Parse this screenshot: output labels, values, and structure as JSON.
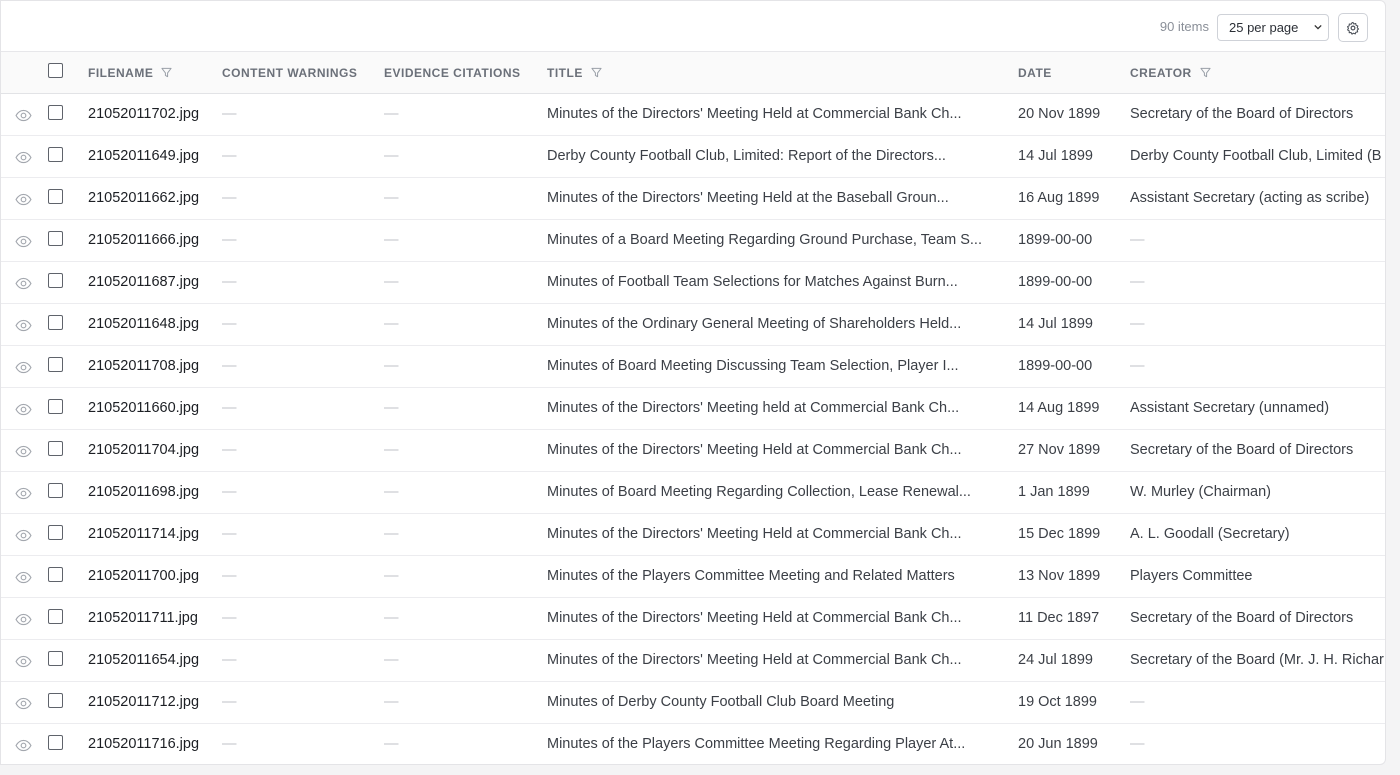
{
  "toolbar": {
    "item_count": "90 items",
    "per_page": "25 per page",
    "settings_icon": "gear-icon"
  },
  "columns": {
    "filename": "FILENAME",
    "content_warnings": "CONTENT WARNINGS",
    "evidence_citations": "EVIDENCE CITATIONS",
    "title": "TITLE",
    "date": "DATE",
    "creator": "CREATOR"
  },
  "empty_placeholder": "—",
  "rows": [
    {
      "filename": "21052011702.jpg",
      "title": "Minutes of the Directors' Meeting Held at Commercial Bank Ch...",
      "date": "20 Nov 1899",
      "creator": "Secretary of the Board of Directors"
    },
    {
      "filename": "21052011649.jpg",
      "title": "Derby County Football Club, Limited: Report of the Directors...",
      "date": "14 Jul 1899",
      "creator": "Derby County Football Club, Limited (B"
    },
    {
      "filename": "21052011662.jpg",
      "title": "Minutes of the Directors' Meeting Held at the Baseball Groun...",
      "date": "16 Aug 1899",
      "creator": "Assistant Secretary (acting as scribe)"
    },
    {
      "filename": "21052011666.jpg",
      "title": "Minutes of a Board Meeting Regarding Ground Purchase, Team S...",
      "date": "1899-00-00",
      "creator": "—"
    },
    {
      "filename": "21052011687.jpg",
      "title": "Minutes of Football Team Selections for Matches Against Burn...",
      "date": "1899-00-00",
      "creator": "—"
    },
    {
      "filename": "21052011648.jpg",
      "title": "Minutes of the Ordinary General Meeting of Shareholders Held...",
      "date": "14 Jul 1899",
      "creator": "—"
    },
    {
      "filename": "21052011708.jpg",
      "title": "Minutes of Board Meeting Discussing Team Selection, Player I...",
      "date": "1899-00-00",
      "creator": "—"
    },
    {
      "filename": "21052011660.jpg",
      "title": "Minutes of the Directors' Meeting held at Commercial Bank Ch...",
      "date": "14 Aug 1899",
      "creator": "Assistant Secretary (unnamed)"
    },
    {
      "filename": "21052011704.jpg",
      "title": "Minutes of the Directors' Meeting Held at Commercial Bank Ch...",
      "date": "27 Nov 1899",
      "creator": "Secretary of the Board of Directors"
    },
    {
      "filename": "21052011698.jpg",
      "title": "Minutes of Board Meeting Regarding Collection, Lease Renewal...",
      "date": "1 Jan 1899",
      "creator": "W. Murley (Chairman)"
    },
    {
      "filename": "21052011714.jpg",
      "title": "Minutes of the Directors' Meeting Held at Commercial Bank Ch...",
      "date": "15 Dec 1899",
      "creator": "A. L. Goodall (Secretary)"
    },
    {
      "filename": "21052011700.jpg",
      "title": "Minutes of the Players Committee Meeting and Related Matters",
      "date": "13 Nov 1899",
      "creator": "Players Committee"
    },
    {
      "filename": "21052011711.jpg",
      "title": "Minutes of the Directors' Meeting Held at Commercial Bank Ch...",
      "date": "11 Dec 1897",
      "creator": "Secretary of the Board of Directors"
    },
    {
      "filename": "21052011654.jpg",
      "title": "Minutes of the Directors' Meeting Held at Commercial Bank Ch...",
      "date": "24 Jul 1899",
      "creator": "Secretary of the Board (Mr. J. H. Richar"
    },
    {
      "filename": "21052011712.jpg",
      "title": "Minutes of Derby County Football Club Board Meeting",
      "date": "19 Oct 1899",
      "creator": "—"
    },
    {
      "filename": "21052011716.jpg",
      "title": "Minutes of the Players Committee Meeting Regarding Player At...",
      "date": "20 Jun 1899",
      "creator": "—"
    }
  ]
}
